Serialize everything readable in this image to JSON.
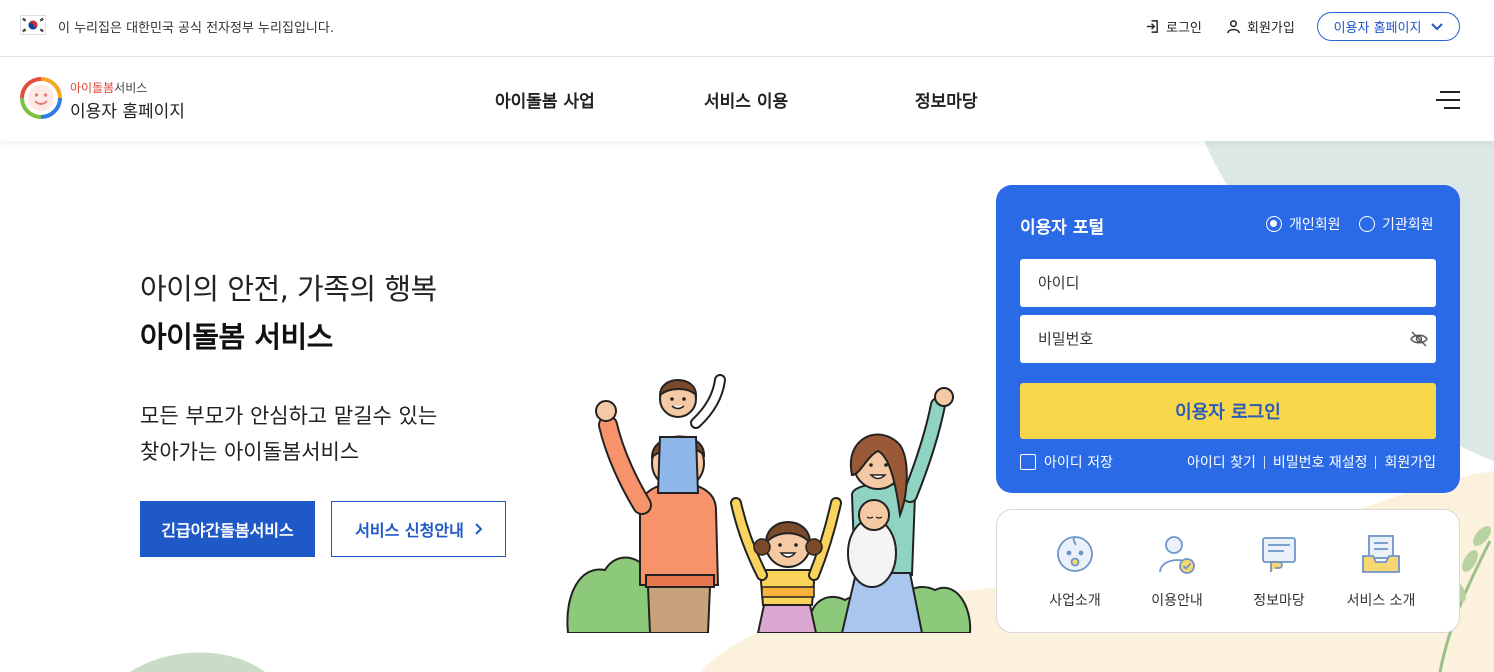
{
  "gov_banner": {
    "text": "이 누리집은 대한민국 공식 전자정부 누리집입니다.",
    "login": "로그인",
    "signup": "회원가입",
    "site_select": "이용자 홈페이지"
  },
  "header": {
    "logo_sub_red": "아이돌봄",
    "logo_sub_rest": "서비스",
    "logo_main": "이용자 홈페이지",
    "nav": [
      "아이돌봄 사업",
      "서비스 이용",
      "정보마당"
    ]
  },
  "hero": {
    "subtitle": "아이의 안전, 가족의 행복",
    "title": "아이돌봄 서비스",
    "desc_line1": "모든 부모가 안심하고 맡길수 있는",
    "desc_line2": "찾아가는 아이돌봄서비스",
    "btn_emergency": "긴급야간돌봄서비스",
    "btn_guide": "서비스 신청안내"
  },
  "login_panel": {
    "title": "이용자 포털",
    "radio_personal": "개인회원",
    "radio_org": "기관회원",
    "radio_selected": "개인회원",
    "id_placeholder": "아이디",
    "pw_placeholder": "비밀번호",
    "login_button": "이용자 로그인",
    "save_id": "아이디 저장",
    "find_id": "아이디 찾기",
    "reset_pw": "비밀번호 재설정",
    "join": "회원가입"
  },
  "quick_menu": [
    {
      "label": "사업소개",
      "icon": "baby-face-icon"
    },
    {
      "label": "이용안내",
      "icon": "user-check-icon"
    },
    {
      "label": "정보마당",
      "icon": "document-hand-icon"
    },
    {
      "label": "서비스 소개",
      "icon": "inbox-tray-icon"
    }
  ],
  "colors": {
    "primary_blue": "#2a6ae6",
    "button_blue": "#1f58c7",
    "login_yellow": "#f8d84a"
  }
}
